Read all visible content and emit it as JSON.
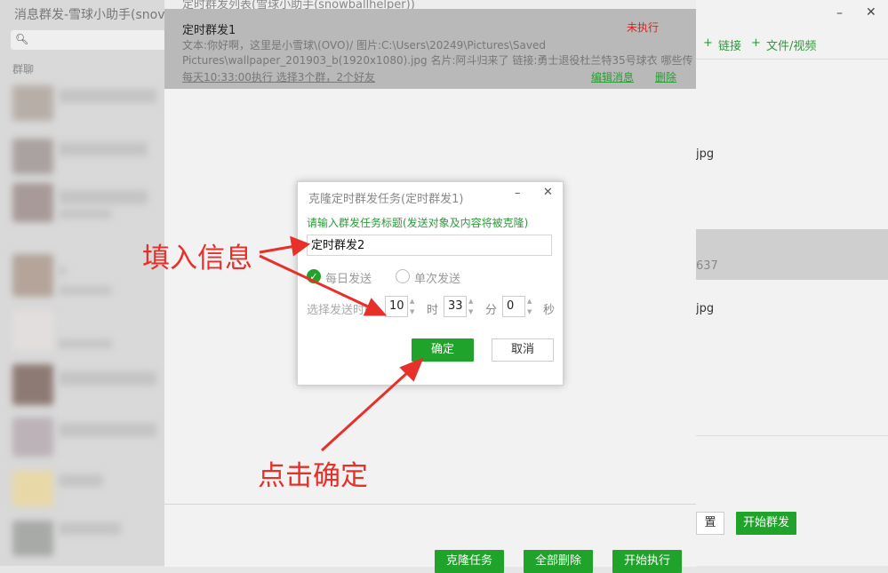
{
  "left_panel": {
    "title": "消息群发-雪球小助手(snov",
    "search_placeholder": "",
    "group_label": "群聊"
  },
  "middle_window": {
    "title": "定时群发列表(雪球小助手(snowballhelper))",
    "task": {
      "name": "定时群发1",
      "status": "未执行",
      "desc_line1": "文本:你好啊，这里是小雪球\\(OVO)/  图片:C:\\Users\\20249\\Pictures\\Saved",
      "desc_line2": "Pictures\\wallpaper_201903_b(1920x1080).jpg 名片:阿斗归来了 链接:勇士退役杜兰特35号球衣 哪些传",
      "schedule": "每天10:33:00执行    选择3个群，2个好友",
      "edit_label": "编辑消息",
      "delete_label": "删除"
    },
    "buttons": {
      "clone": "克隆任务",
      "delete_all": "全部删除",
      "start": "开始执行"
    }
  },
  "right_window": {
    "minimize": "–",
    "close": "✕",
    "toolbar": {
      "plus1": "+",
      "link": "链接",
      "plus2": "+",
      "file_video": "文件/视频"
    },
    "file_ext_1": "jpg",
    "number": "637",
    "file_ext_2": "jpg",
    "reset_label": "置",
    "start_broadcast": "开始群发"
  },
  "dialog": {
    "title": "克隆定时群发任务(定时群发1)",
    "minimize": "–",
    "close": "✕",
    "prompt": "请输入群发任务标题(发送对象及内容将被克隆)",
    "title_input_value": "定时群发2",
    "daily_label": "每日发送",
    "once_label": "单次发送",
    "time_label": "选择发送时间",
    "hour": "10",
    "hour_unit": "时",
    "minute": "33",
    "minute_unit": "分",
    "second": "0",
    "second_unit": "秒",
    "ok": "确定",
    "cancel": "取消"
  },
  "annotations": {
    "fill_info": "填入信息",
    "click_ok": "点击确定"
  },
  "colors": {
    "accent_green": "#20a32a",
    "annotation_red": "#e8302a",
    "status_red": "#d32525"
  }
}
